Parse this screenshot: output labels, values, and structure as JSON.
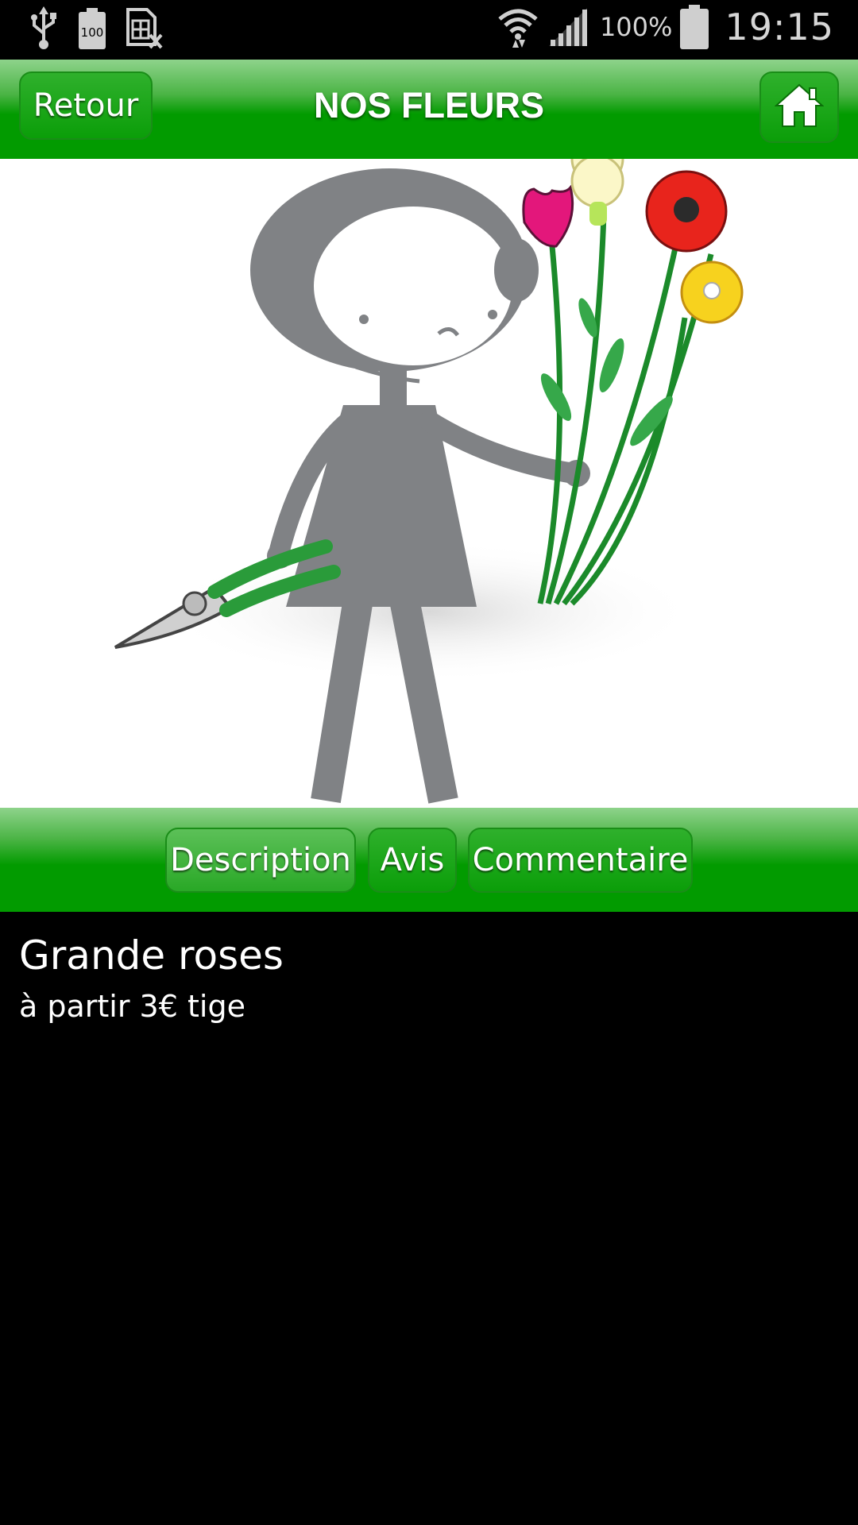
{
  "status_bar": {
    "battery_percent": "100%",
    "time": "19:15",
    "battery_badge": "100",
    "left_icons": [
      "usb-icon",
      "battery-full-notification-icon",
      "sim-missing-icon"
    ],
    "right_icons": [
      "wifi-icon",
      "signal-icon",
      "battery-icon"
    ]
  },
  "header": {
    "back_label": "Retour",
    "title": "NOS FLEURS",
    "home_icon": "home-icon"
  },
  "hero": {
    "illustration": "woman-holding-flowers-and-pruning-shears"
  },
  "tabs": [
    {
      "label": "Description",
      "active": true
    },
    {
      "label": "Avis",
      "active": false
    },
    {
      "label": "Commentaire",
      "active": false
    }
  ],
  "product": {
    "name": "Grande roses",
    "price_text": "à partir 3€ tige"
  },
  "colors": {
    "header_green": "#029b00",
    "header_light": "#8ed38b",
    "figure_gray": "#808285",
    "background": "#000000"
  }
}
